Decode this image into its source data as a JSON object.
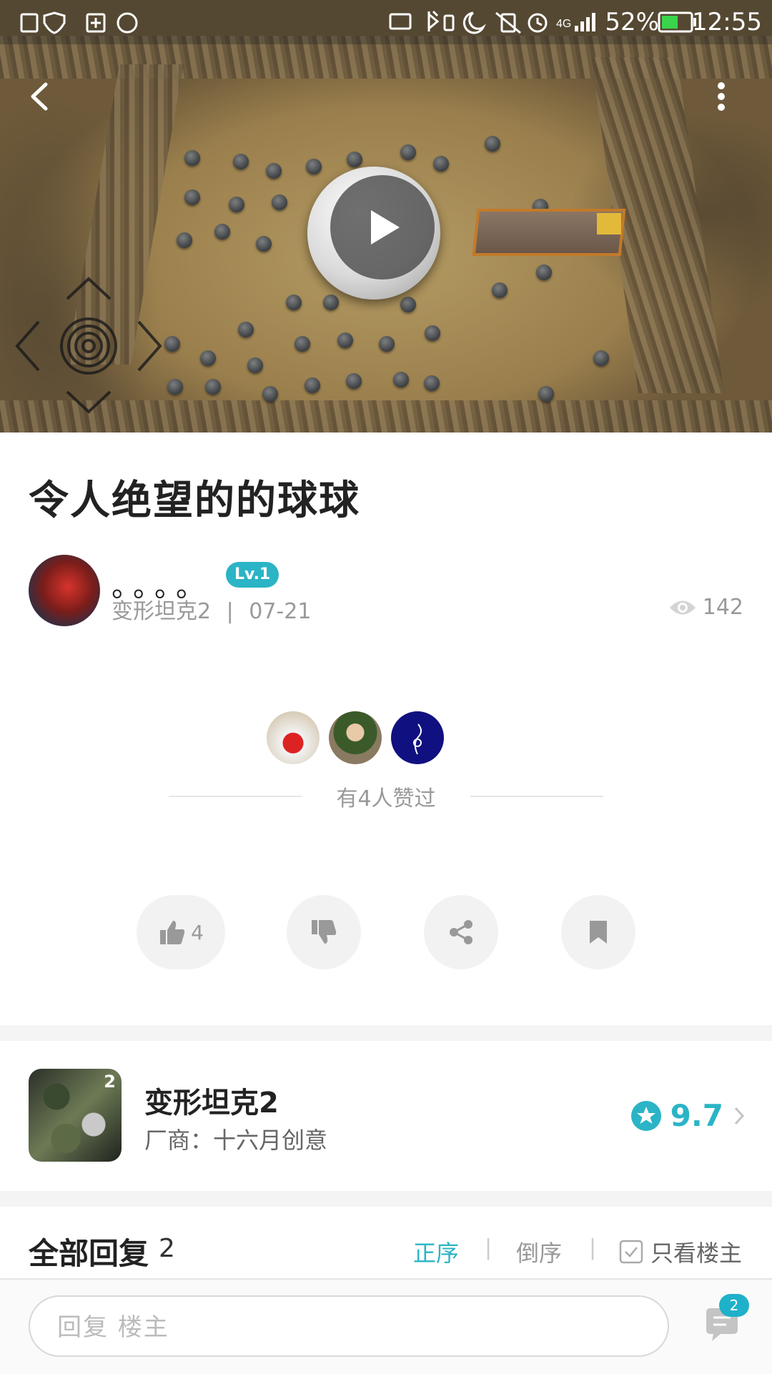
{
  "status_bar": {
    "battery_percent": "52%",
    "time": "12:55",
    "network": "4G"
  },
  "post": {
    "title": "令人绝望的的球球",
    "author": "。。。。",
    "level": "Lv.1",
    "game_tag": "变形坦克2",
    "date": "07-21",
    "separator": "|",
    "views": "142",
    "likes_text": "有4人赞过"
  },
  "actions": {
    "like_count": "4"
  },
  "game": {
    "name": "变形坦克2",
    "vendor": "厂商：十六月创意",
    "rating": "9.7",
    "icon_badge": "2"
  },
  "replies": {
    "title": "全部回复",
    "count": "2",
    "sort_asc": "正序",
    "sort_desc": "倒序",
    "only_op": "只看楼主",
    "sep": "|"
  },
  "bottom": {
    "reply_placeholder": "回复  楼主",
    "comment_badge": "2"
  },
  "colors": {
    "accent": "#2bb4c6",
    "muted": "#999999",
    "title": "#222222"
  },
  "icons": {
    "back": "back-icon",
    "more": "more-vert-icon",
    "play": "play-icon",
    "eye": "eye-icon",
    "like": "thumb-up-icon",
    "dislike": "thumb-down-icon",
    "share": "share-icon",
    "bookmark": "bookmark-icon",
    "star": "star-icon",
    "chevron": "chevron-right-icon",
    "checkbox": "checkbox-icon",
    "comment": "comment-icon"
  }
}
